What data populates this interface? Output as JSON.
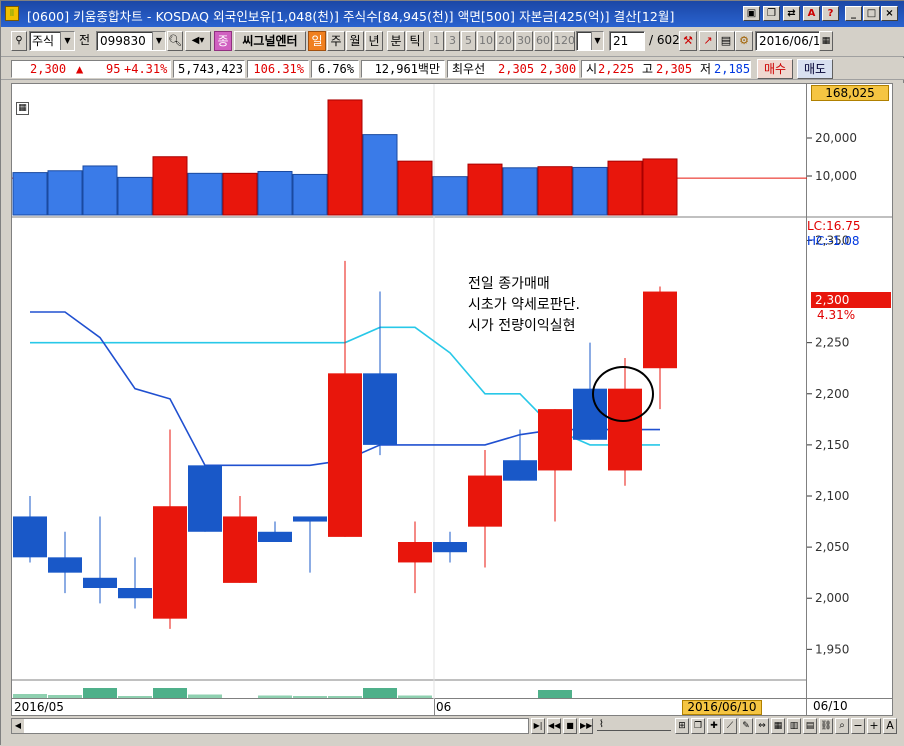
{
  "window": {
    "title": "[0600] 키움종합차트 - KOSDAQ 외국인보유[1,048(천)] 주식수[84,945(천)] 액면[500] 자본금[425(억)] 결산[12월]"
  },
  "toolbar": {
    "market_label": "주식",
    "prev_label": "전",
    "code_value": "099830",
    "signal_badge": "종",
    "signal_center": "씨그널엔터",
    "period_day": "일",
    "period_week": "주",
    "period_month": "월",
    "period_year": "년",
    "period_minute": "분",
    "period_tick": "틱",
    "intervals": [
      "1",
      "3",
      "5",
      "10",
      "20",
      "30",
      "60",
      "120"
    ],
    "count_value": "21",
    "count_total": "/ 602",
    "date_value": "2016/06/1"
  },
  "quote": {
    "price": "2,300",
    "change_arrow": "▲",
    "change": "95",
    "change_pct": "+4.31%",
    "volume": "5,743,423",
    "volume_ratio": "106.31%",
    "turnover": "6.76%",
    "amount": "12,961백만",
    "best_label": "최우선",
    "best_ask": "2,305",
    "best_bid": "2,300",
    "open_label": "시",
    "open": "2,225",
    "high_label": "고",
    "high": "2,305",
    "low_label": "저",
    "low": "2,185",
    "buy_label": "매수",
    "sell_label": "매도"
  },
  "volume_panel": {
    "max_label": "168,025",
    "ticks": [
      "20,000",
      "10,000"
    ]
  },
  "price_panel": {
    "lc_label": "LC:16.75",
    "hc_label": "HC:-1.08",
    "ticks": [
      "2,350",
      "2,300",
      "2,250",
      "2,200",
      "2,150",
      "2,100",
      "2,050",
      "2,000",
      "1,950"
    ],
    "current_price": "2,300",
    "current_pct": "4.31%",
    "annotation": [
      "전일 종가매매",
      "시초가 약세로판단.",
      "시가 전량이익실현"
    ]
  },
  "x_axis": {
    "label_start": "2016/05",
    "label_mid": "06",
    "cursor_date": "2016/06/10",
    "right_date": "06/10"
  },
  "colors": {
    "up": "#e8160c",
    "down": "#1958c8",
    "line_dark": "#2050d0",
    "line_light": "#28c8e8",
    "title_bar": "#1b47a6",
    "cursor_badge": "#f5c542"
  },
  "chart_data": {
    "type": "candlestick",
    "price_unit": "KRW",
    "candles": [
      {
        "o": 2080,
        "h": 2100,
        "l": 2035,
        "c": 2040
      },
      {
        "o": 2040,
        "h": 2065,
        "l": 2005,
        "c": 2025
      },
      {
        "o": 2020,
        "h": 2080,
        "l": 1995,
        "c": 2010
      },
      {
        "o": 2010,
        "h": 2040,
        "l": 1990,
        "c": 2000
      },
      {
        "o": 1980,
        "h": 2165,
        "l": 1970,
        "c": 2090
      },
      {
        "o": 2130,
        "h": 2130,
        "l": 2065,
        "c": 2065
      },
      {
        "o": 2015,
        "h": 2100,
        "l": 2015,
        "c": 2080
      },
      {
        "o": 2065,
        "h": 2075,
        "l": 2055,
        "c": 2055
      },
      {
        "o": 2080,
        "h": 2080,
        "l": 2025,
        "c": 2075
      },
      {
        "o": 2060,
        "h": 2330,
        "l": 2060,
        "c": 2220
      },
      {
        "o": 2220,
        "h": 2300,
        "l": 2140,
        "c": 2150
      },
      {
        "o": 2035,
        "h": 2075,
        "l": 2005,
        "c": 2055
      },
      {
        "o": 2055,
        "h": 2065,
        "l": 2035,
        "c": 2045
      },
      {
        "o": 2070,
        "h": 2145,
        "l": 2030,
        "c": 2120
      },
      {
        "o": 2135,
        "h": 2165,
        "l": 2115,
        "c": 2115
      },
      {
        "o": 2125,
        "h": 2185,
        "l": 2075,
        "c": 2185
      },
      {
        "o": 2205,
        "h": 2250,
        "l": 2155,
        "c": 2155
      },
      {
        "o": 2125,
        "h": 2235,
        "l": 2110,
        "c": 2205
      },
      {
        "o": 2225,
        "h": 2305,
        "l": 2185,
        "c": 2300
      }
    ],
    "line_dark": [
      2280,
      2280,
      2255,
      2205,
      2195,
      2130,
      2130,
      2130,
      2130,
      2135,
      2150,
      2150,
      2150,
      2150,
      2160,
      2165,
      2165,
      2165,
      2165
    ],
    "line_light": [
      2250,
      2250,
      2250,
      2250,
      2250,
      2250,
      2250,
      2250,
      2250,
      2250,
      2265,
      2265,
      2240,
      2200,
      2200,
      2165,
      2150,
      2150,
      2150
    ],
    "volume": [
      115000,
      120000,
      133000,
      102000,
      158000,
      113000,
      113000,
      118000,
      110000,
      312000,
      218000,
      146000,
      104000,
      138000,
      128000,
      131000,
      129000,
      146000,
      152000
    ],
    "volume_up": [
      false,
      false,
      false,
      false,
      true,
      false,
      true,
      false,
      false,
      true,
      false,
      true,
      false,
      true,
      false,
      true,
      false,
      true,
      true
    ],
    "ylim": [
      1920,
      2370
    ]
  }
}
